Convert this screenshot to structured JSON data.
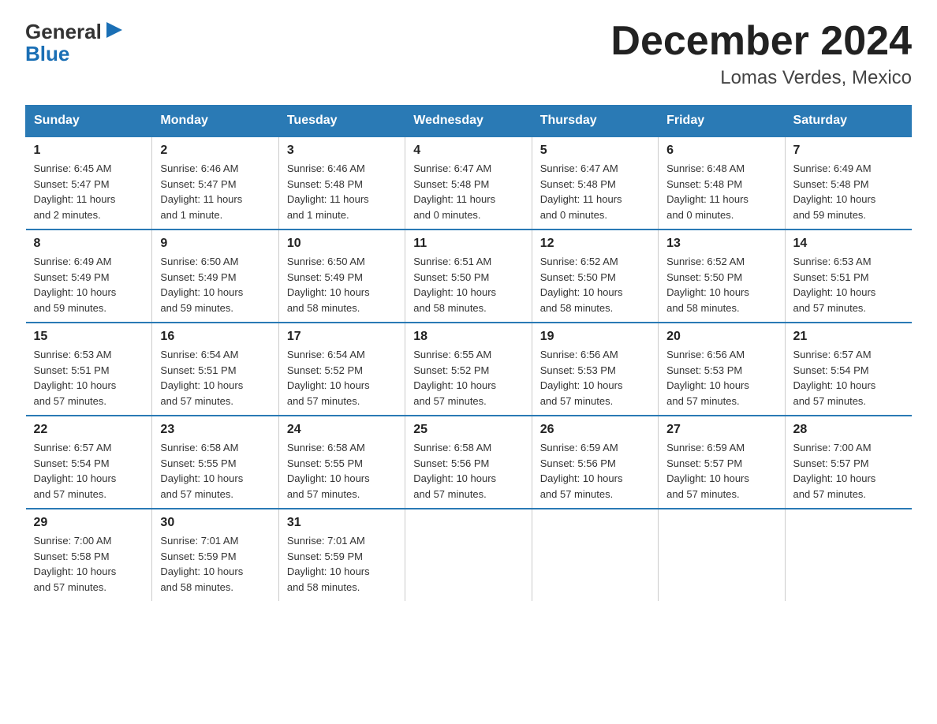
{
  "logo": {
    "text1": "General",
    "text2": "Blue"
  },
  "header": {
    "title": "December 2024",
    "subtitle": "Lomas Verdes, Mexico"
  },
  "weekdays": [
    "Sunday",
    "Monday",
    "Tuesday",
    "Wednesday",
    "Thursday",
    "Friday",
    "Saturday"
  ],
  "weeks": [
    [
      {
        "day": "1",
        "info": "Sunrise: 6:45 AM\nSunset: 5:47 PM\nDaylight: 11 hours\nand 2 minutes."
      },
      {
        "day": "2",
        "info": "Sunrise: 6:46 AM\nSunset: 5:47 PM\nDaylight: 11 hours\nand 1 minute."
      },
      {
        "day": "3",
        "info": "Sunrise: 6:46 AM\nSunset: 5:48 PM\nDaylight: 11 hours\nand 1 minute."
      },
      {
        "day": "4",
        "info": "Sunrise: 6:47 AM\nSunset: 5:48 PM\nDaylight: 11 hours\nand 0 minutes."
      },
      {
        "day": "5",
        "info": "Sunrise: 6:47 AM\nSunset: 5:48 PM\nDaylight: 11 hours\nand 0 minutes."
      },
      {
        "day": "6",
        "info": "Sunrise: 6:48 AM\nSunset: 5:48 PM\nDaylight: 11 hours\nand 0 minutes."
      },
      {
        "day": "7",
        "info": "Sunrise: 6:49 AM\nSunset: 5:48 PM\nDaylight: 10 hours\nand 59 minutes."
      }
    ],
    [
      {
        "day": "8",
        "info": "Sunrise: 6:49 AM\nSunset: 5:49 PM\nDaylight: 10 hours\nand 59 minutes."
      },
      {
        "day": "9",
        "info": "Sunrise: 6:50 AM\nSunset: 5:49 PM\nDaylight: 10 hours\nand 59 minutes."
      },
      {
        "day": "10",
        "info": "Sunrise: 6:50 AM\nSunset: 5:49 PM\nDaylight: 10 hours\nand 58 minutes."
      },
      {
        "day": "11",
        "info": "Sunrise: 6:51 AM\nSunset: 5:50 PM\nDaylight: 10 hours\nand 58 minutes."
      },
      {
        "day": "12",
        "info": "Sunrise: 6:52 AM\nSunset: 5:50 PM\nDaylight: 10 hours\nand 58 minutes."
      },
      {
        "day": "13",
        "info": "Sunrise: 6:52 AM\nSunset: 5:50 PM\nDaylight: 10 hours\nand 58 minutes."
      },
      {
        "day": "14",
        "info": "Sunrise: 6:53 AM\nSunset: 5:51 PM\nDaylight: 10 hours\nand 57 minutes."
      }
    ],
    [
      {
        "day": "15",
        "info": "Sunrise: 6:53 AM\nSunset: 5:51 PM\nDaylight: 10 hours\nand 57 minutes."
      },
      {
        "day": "16",
        "info": "Sunrise: 6:54 AM\nSunset: 5:51 PM\nDaylight: 10 hours\nand 57 minutes."
      },
      {
        "day": "17",
        "info": "Sunrise: 6:54 AM\nSunset: 5:52 PM\nDaylight: 10 hours\nand 57 minutes."
      },
      {
        "day": "18",
        "info": "Sunrise: 6:55 AM\nSunset: 5:52 PM\nDaylight: 10 hours\nand 57 minutes."
      },
      {
        "day": "19",
        "info": "Sunrise: 6:56 AM\nSunset: 5:53 PM\nDaylight: 10 hours\nand 57 minutes."
      },
      {
        "day": "20",
        "info": "Sunrise: 6:56 AM\nSunset: 5:53 PM\nDaylight: 10 hours\nand 57 minutes."
      },
      {
        "day": "21",
        "info": "Sunrise: 6:57 AM\nSunset: 5:54 PM\nDaylight: 10 hours\nand 57 minutes."
      }
    ],
    [
      {
        "day": "22",
        "info": "Sunrise: 6:57 AM\nSunset: 5:54 PM\nDaylight: 10 hours\nand 57 minutes."
      },
      {
        "day": "23",
        "info": "Sunrise: 6:58 AM\nSunset: 5:55 PM\nDaylight: 10 hours\nand 57 minutes."
      },
      {
        "day": "24",
        "info": "Sunrise: 6:58 AM\nSunset: 5:55 PM\nDaylight: 10 hours\nand 57 minutes."
      },
      {
        "day": "25",
        "info": "Sunrise: 6:58 AM\nSunset: 5:56 PM\nDaylight: 10 hours\nand 57 minutes."
      },
      {
        "day": "26",
        "info": "Sunrise: 6:59 AM\nSunset: 5:56 PM\nDaylight: 10 hours\nand 57 minutes."
      },
      {
        "day": "27",
        "info": "Sunrise: 6:59 AM\nSunset: 5:57 PM\nDaylight: 10 hours\nand 57 minutes."
      },
      {
        "day": "28",
        "info": "Sunrise: 7:00 AM\nSunset: 5:57 PM\nDaylight: 10 hours\nand 57 minutes."
      }
    ],
    [
      {
        "day": "29",
        "info": "Sunrise: 7:00 AM\nSunset: 5:58 PM\nDaylight: 10 hours\nand 57 minutes."
      },
      {
        "day": "30",
        "info": "Sunrise: 7:01 AM\nSunset: 5:59 PM\nDaylight: 10 hours\nand 58 minutes."
      },
      {
        "day": "31",
        "info": "Sunrise: 7:01 AM\nSunset: 5:59 PM\nDaylight: 10 hours\nand 58 minutes."
      },
      {
        "day": "",
        "info": ""
      },
      {
        "day": "",
        "info": ""
      },
      {
        "day": "",
        "info": ""
      },
      {
        "day": "",
        "info": ""
      }
    ]
  ]
}
